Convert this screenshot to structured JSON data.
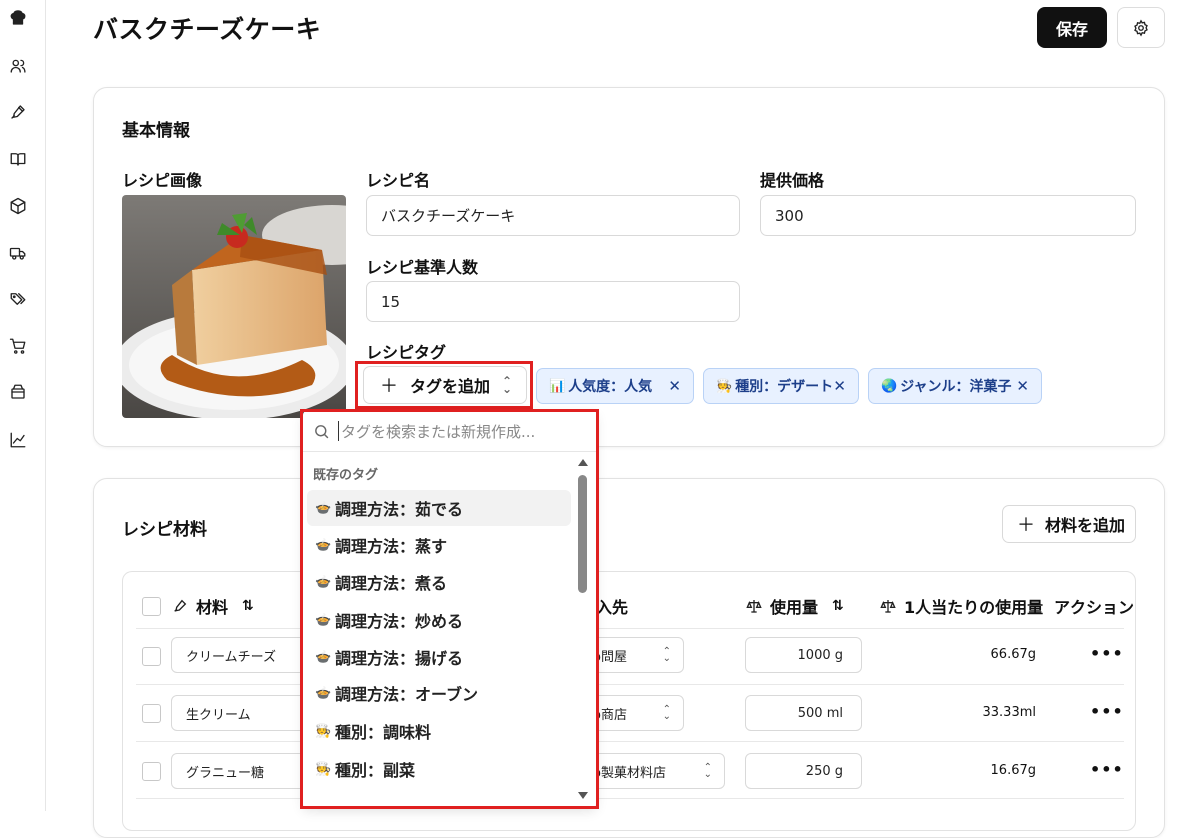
{
  "page": {
    "title": "バスクチーズケーキ",
    "save_label": "保存"
  },
  "sidebar": {
    "icons": [
      "chef-hat-icon",
      "users-icon",
      "pen-icon",
      "book-icon",
      "box-icon",
      "truck-icon",
      "tags-icon",
      "cart-icon",
      "tray-icon",
      "chart-icon"
    ]
  },
  "basic": {
    "section_title": "基本情報",
    "image_label": "レシピ画像",
    "name_label": "レシピ名",
    "name_value": "バスクチーズケーキ",
    "price_label": "提供価格",
    "price_value": "300",
    "servings_label": "レシピ基準人数",
    "servings_value": "15",
    "tags_label": "レシピタグ",
    "add_tag_label": "タグを追加",
    "tags": [
      {
        "emoji": "📊",
        "label": "人気度：人気"
      },
      {
        "emoji": "🧑‍🍳",
        "label": "種別：デザート"
      },
      {
        "emoji": "🌏",
        "label": "ジャンル：洋菓子"
      }
    ]
  },
  "tag_dropdown": {
    "search_placeholder": "タグを検索または新規作成...",
    "group_label": "既存のタグ",
    "items": [
      {
        "emoji": "🍲",
        "label": "調理方法：茹でる"
      },
      {
        "emoji": "🍲",
        "label": "調理方法：蒸す"
      },
      {
        "emoji": "🍲",
        "label": "調理方法：煮る"
      },
      {
        "emoji": "🍲",
        "label": "調理方法：炒める"
      },
      {
        "emoji": "🍲",
        "label": "調理方法：揚げる"
      },
      {
        "emoji": "🍲",
        "label": "調理方法：オーブン"
      },
      {
        "emoji": "🧑‍🍳",
        "label": "種別：調味料"
      },
      {
        "emoji": "🧑‍🍳",
        "label": "種別：副菜"
      }
    ]
  },
  "ingredients": {
    "section_title": "レシピ材料",
    "add_label": "材料を追加",
    "headers": {
      "material": "材料",
      "supplier": "入先",
      "amount": "使用量",
      "per_person": "1人当たりの使用量",
      "action": "アクション"
    },
    "rows": [
      {
        "name": "クリームチーズ",
        "supplier": "o問屋",
        "amount": "1000 g",
        "per_person": "66.67g"
      },
      {
        "name": "生クリーム",
        "supplier": "o商店",
        "amount": "500 ml",
        "per_person": "33.33ml"
      },
      {
        "name": "グラニュー糖",
        "supplier": "o製菓材料店",
        "amount": "250 g",
        "per_person": "16.67g"
      }
    ],
    "action_glyph": "•••"
  }
}
